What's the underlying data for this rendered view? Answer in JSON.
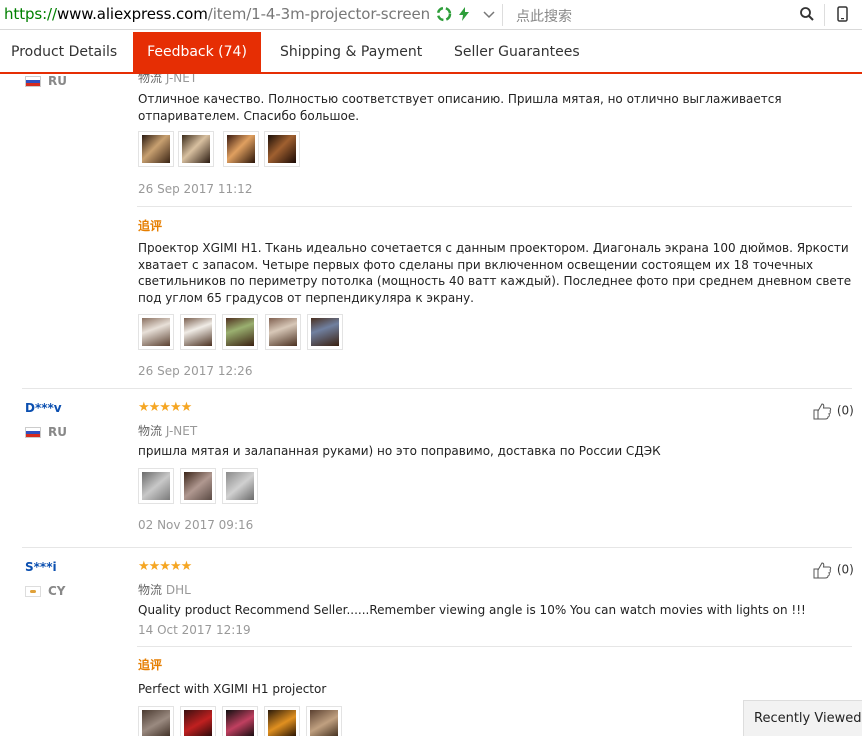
{
  "address_bar": {
    "url_scheme": "https://",
    "url_host": "www.aliexpress.com",
    "url_path": "/item/1-4-3m-projector-screen",
    "search_placeholder": "点此搜索"
  },
  "tabs": [
    {
      "label": "Product Details"
    },
    {
      "label": "Feedback (74)"
    },
    {
      "label": "Shipping & Payment"
    },
    {
      "label": "Seller Guarantees"
    }
  ],
  "reviews": [
    {
      "country": "RU",
      "logistics_label": "物流",
      "logistics_value": "J-NET",
      "text": "Отличное качество. Полностью соответствует описанию. Пришла мятая, но отлично выглаживается отпаривателем. Спасибо большое.",
      "date": "26 Sep 2017 11:12",
      "followup_label": "追评",
      "followup_text": "Проектор XGIMI H1. Ткань идеально сочетается с данным проектором. Диагональ экрана 100 дюймов. Яркости хватает с запасом. Четыре первых фото сделаны при включенном освещении состоящем их 18 точечных светильников по периметру потолка (мощность 40 ватт каждый). Последнее фото при среднем дневном свете под углом 65 градусов от перпендикуляра к экрану.",
      "followup_date": "26 Sep 2017 12:26"
    },
    {
      "user": "D***v",
      "country": "RU",
      "stars": "★★★★★",
      "logistics_label": "物流",
      "logistics_value": "J-NET",
      "text": "пришла мятая и залапанная руками) но это поправимо, доставка по России СДЭК",
      "date": "02 Nov 2017 09:16",
      "likes": "(0)"
    },
    {
      "user": "S***i",
      "country": "CY",
      "stars": "★★★★★",
      "logistics_label": "物流",
      "logistics_value": "DHL",
      "text": "Quality product Recommend Seller......Remember viewing angle is 10% You can watch movies with lights on !!!",
      "date": "14 Oct 2017 12:19",
      "likes": "(0)",
      "followup_label": "追评",
      "followup_text": "Perfect with XGIMI H1 projector"
    }
  ],
  "recently_viewed": "Recently Viewed",
  "colors": {
    "accent": "#e62e04",
    "star": "#f5a623",
    "username": "#0b4fb0",
    "followup": "#e67e00"
  }
}
